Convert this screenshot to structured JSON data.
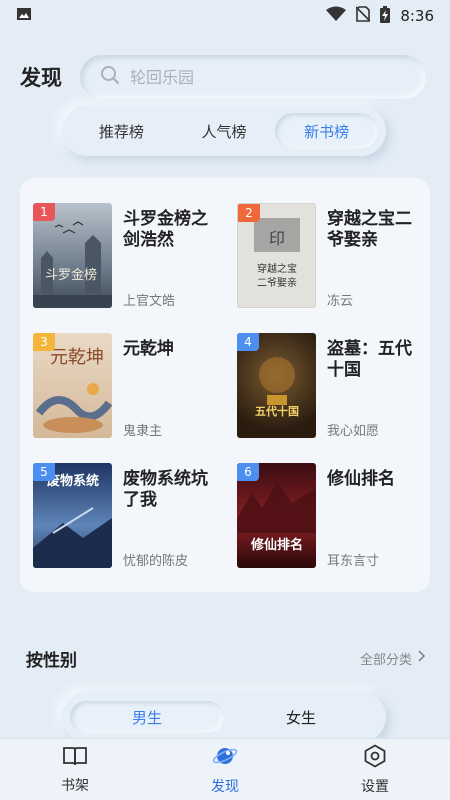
{
  "status_bar": {
    "time": "8:36"
  },
  "header": {
    "title": "发现"
  },
  "search": {
    "placeholder": "轮回乐园"
  },
  "rank_tabs": [
    {
      "label": "推荐榜",
      "active": false
    },
    {
      "label": "人气榜",
      "active": false
    },
    {
      "label": "新书榜",
      "active": true
    }
  ],
  "books": [
    {
      "rank": "1",
      "title": "斗罗金榜之剑浩然",
      "author": "上官文皓",
      "badge_color": "#e8555b",
      "cover_color": "#7d8a98"
    },
    {
      "rank": "2",
      "title": "穿越之宝二爷娶亲",
      "author": "冻云",
      "badge_color": "#f0693a",
      "cover_color": "#dcdad4"
    },
    {
      "rank": "3",
      "title": "元乾坤",
      "author": "鬼隶主",
      "badge_color": "#f4b53a",
      "cover_color": "#d9c8b5"
    },
    {
      "rank": "4",
      "title": "盗墓：五代十国",
      "author": "我心如愿",
      "badge_color": "#4c8ff0",
      "cover_color": "#3a2a1c"
    },
    {
      "rank": "5",
      "title": "废物系统坑了我",
      "author": "忧郁的陈皮",
      "badge_color": "#4c8ff0",
      "cover_color": "#2e4c7e"
    },
    {
      "rank": "6",
      "title": "修仙排名",
      "author": "耳东言寸",
      "badge_color": "#4c8ff0",
      "cover_color": "#5b1518"
    }
  ],
  "covers": [
    {
      "text": "斗罗金榜"
    },
    {
      "text": "穿越之宝\n二爷娶亲"
    },
    {
      "text": "元乾坤"
    },
    {
      "text": "五代十国"
    },
    {
      "text": "废物系统"
    },
    {
      "text": "修仙排名"
    }
  ],
  "gender": {
    "title": "按性别",
    "all_categories": "全部分类",
    "tabs": [
      {
        "label": "男生",
        "active": true
      },
      {
        "label": "女生",
        "active": false
      }
    ]
  },
  "bottom_nav": [
    {
      "label": "书架",
      "icon": "book-icon",
      "active": false
    },
    {
      "label": "发现",
      "icon": "planet-icon",
      "active": true
    },
    {
      "label": "设置",
      "icon": "settings-icon",
      "active": false
    }
  ]
}
